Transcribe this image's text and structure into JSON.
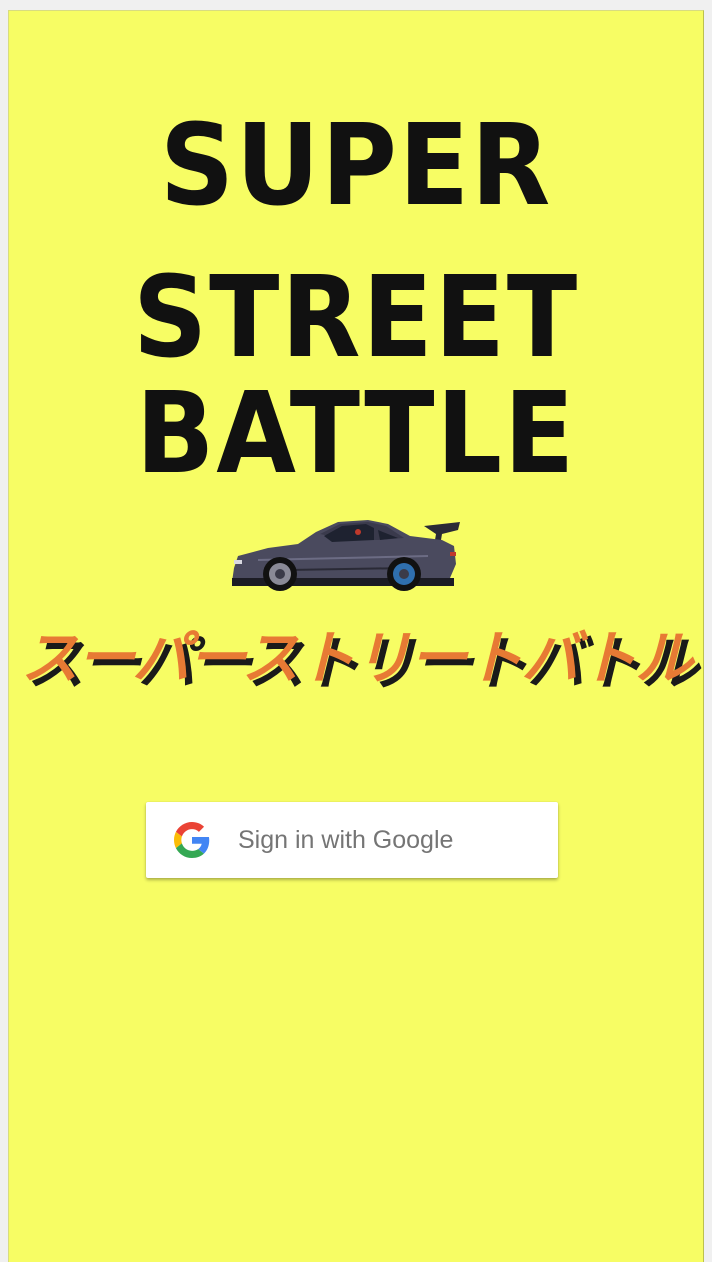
{
  "app": {
    "title_lines": [
      "SUPER",
      "STREET",
      "BATTLE"
    ],
    "subtitle_jp": "スーパーストリートバトル",
    "mascot_icon": "sports-car-icon"
  },
  "signin": {
    "label": "Sign in with Google",
    "icon": "google-logo-icon"
  },
  "colors": {
    "background": "#f7fd64",
    "title": "#111111",
    "subtitle": "#e77a34",
    "subtitle_shadow": "#1a1a1a",
    "button_bg": "#ffffff",
    "button_text": "#757575"
  }
}
